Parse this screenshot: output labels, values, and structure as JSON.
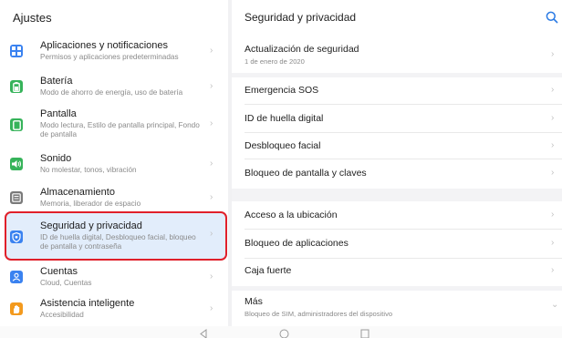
{
  "colors": {
    "accent": "#2a7ae4",
    "selection_border": "#e0202a",
    "selection_fill": "#e2edfb"
  },
  "left": {
    "title": "Ajustes",
    "items": [
      {
        "icon": "apps-grid-icon",
        "color": "#3a82f0",
        "title": "Aplicaciones y notificaciones",
        "subtitle": "Permisos y aplicaciones predeterminadas"
      },
      {
        "icon": "battery-icon",
        "color": "#36b35a",
        "title": "Batería",
        "subtitle": "Modo de ahorro de energía, uso de batería"
      },
      {
        "icon": "display-icon",
        "color": "#36b35a",
        "title": "Pantalla",
        "subtitle": "Modo lectura, Estilo de pantalla principal, Fondo de pantalla"
      },
      {
        "icon": "sound-icon",
        "color": "#36b35a",
        "title": "Sonido",
        "subtitle": "No molestar, tonos, vibración"
      },
      {
        "icon": "storage-icon",
        "color": "#7a7a7a",
        "title": "Almacenamiento",
        "subtitle": "Memoria, liberador de espacio"
      },
      {
        "icon": "shield-icon",
        "color": "#3a82f0",
        "title": "Seguridad y privacidad",
        "subtitle": "ID de huella digital, Desbloqueo facial, bloqueo de pantalla y contraseña"
      },
      {
        "icon": "account-icon",
        "color": "#3a82f0",
        "title": "Cuentas",
        "subtitle": "Cloud, Cuentas"
      },
      {
        "icon": "hand-icon",
        "color": "#f39a1e",
        "title": "Asistencia inteligente",
        "subtitle": "Accesibilidad"
      }
    ]
  },
  "right": {
    "title": "Seguridad y privacidad",
    "items": [
      {
        "title": "Actualización de seguridad",
        "subtitle": "1 de enero de 2020"
      },
      {
        "title": "Emergencia SOS"
      },
      {
        "title": "ID de huella digital"
      },
      {
        "title": "Desbloqueo facial"
      },
      {
        "title": "Bloqueo de pantalla y claves"
      },
      {
        "title": "Acceso a la ubicación"
      },
      {
        "title": "Bloqueo de aplicaciones"
      },
      {
        "title": "Caja fuerte"
      },
      {
        "title": "Más",
        "subtitle": "Bloqueo de SIM, administradores del dispositivo"
      }
    ]
  },
  "glyphs": {
    "chevron": "›",
    "chevron_down": "⌄"
  }
}
